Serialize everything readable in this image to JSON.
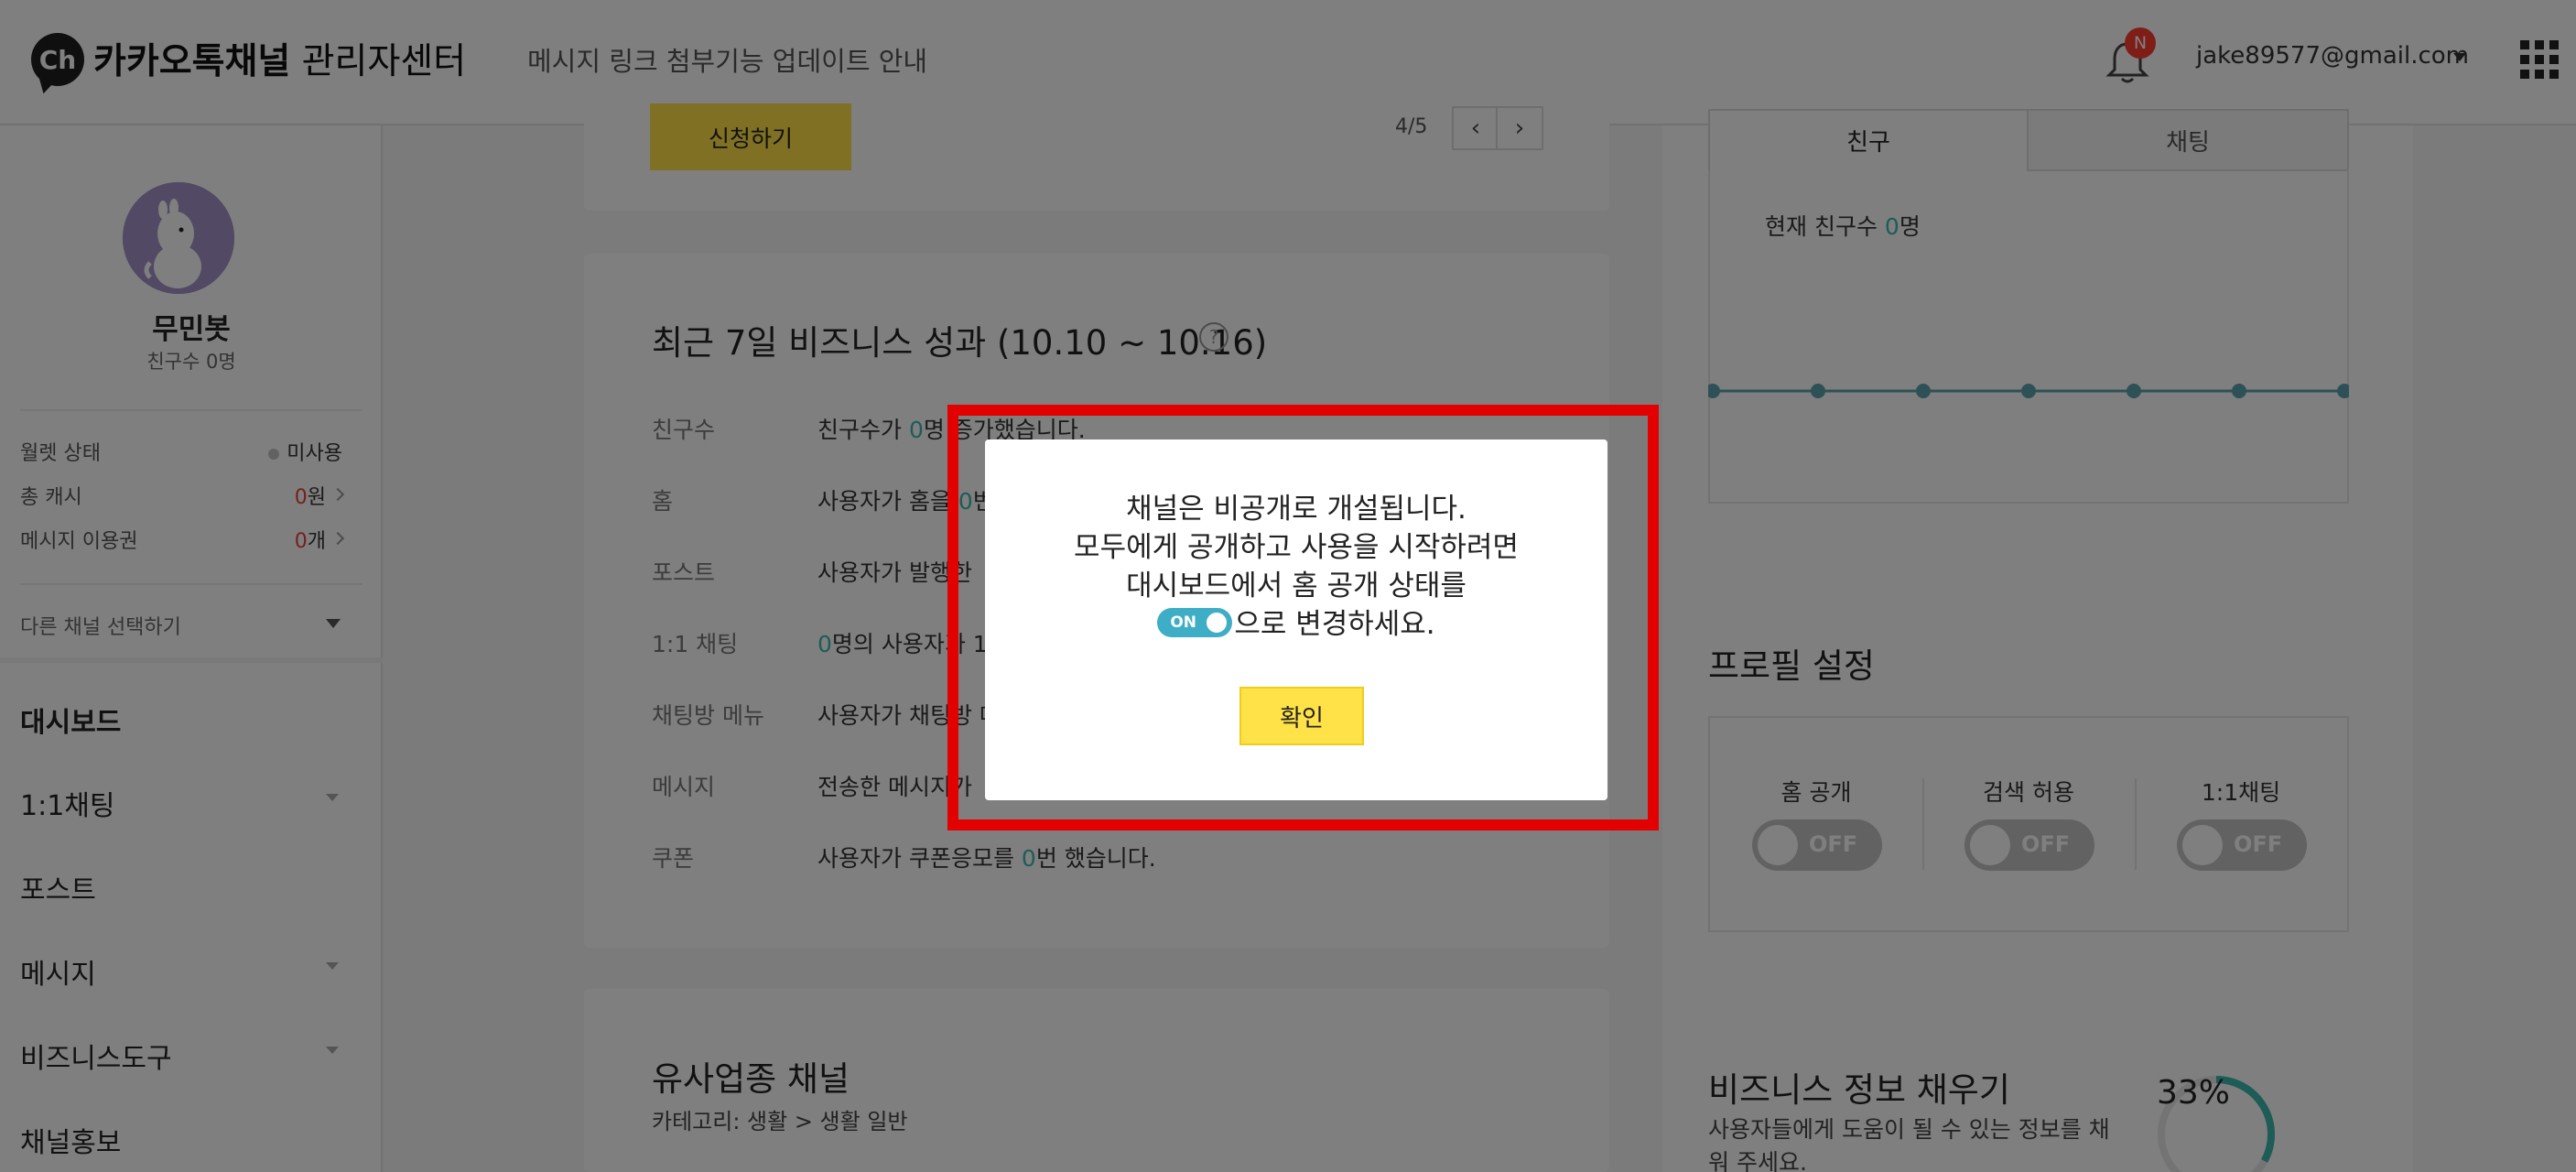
{
  "header": {
    "logo_text": "Ch",
    "title_bold": "카카오톡채널",
    "title_rest": " 관리자센터",
    "notice": "메시지 링크 첨부기능 업데이트 안내",
    "notification_badge": "N",
    "account": "jake89577@gmail.com"
  },
  "sidebar": {
    "profile_name": "무민봇",
    "friends_label": "친구수 ",
    "friends_count": "0명",
    "stats": [
      {
        "label": "월렛 상태",
        "value": "미사용"
      },
      {
        "label": "총 캐시",
        "value_num": "0",
        "value_unit": "원"
      },
      {
        "label": "메시지 이용권",
        "value_num": "0",
        "value_unit": "개"
      }
    ],
    "channel_select": "다른 채널 선택하기",
    "menu": [
      "대시보드",
      "1:1채팅",
      "포스트",
      "메시지",
      "비즈니스도구",
      "채널홍보"
    ]
  },
  "main": {
    "apply_button": "신청하기",
    "pager": "4/5",
    "prev": "‹",
    "next": "›",
    "perf_title": "최근 7일 비즈니스 성과 (10.10 ~ 10.16)",
    "help": "?",
    "rows": [
      {
        "label": "친구수",
        "pre": "친구수가 ",
        "num": "0",
        "post": "명 증가했습니다."
      },
      {
        "label": "홈",
        "pre": "사용자가 홈을 ",
        "num": "0",
        "post": "번"
      },
      {
        "label": "포스트",
        "pre": "사용자가 발행한 ",
        "num": "",
        "post": ""
      },
      {
        "label": "1:1 채팅",
        "pre": "",
        "num": "0",
        "post": "명의 사용자가 1"
      },
      {
        "label": "채팅방 메뉴",
        "pre": "사용자가 채팅방 메",
        "num": "",
        "post": ""
      },
      {
        "label": "메시지",
        "pre": "전송한 메시지가 ",
        "num": "",
        "post": ""
      },
      {
        "label": "쿠폰",
        "pre": "사용자가 쿠폰응모를 ",
        "num": "0",
        "post": "번 했습니다."
      }
    ],
    "similar_title": "유사업종 채널",
    "similar_category": "카테고리: 생활 > 생활 일반"
  },
  "right": {
    "tabs": [
      "친구",
      "채팅"
    ],
    "friends_now_pre": "현재 친구수 ",
    "friends_now_num": "0",
    "friends_now_post": "명",
    "chart_data": {
      "type": "line",
      "series": [
        {
          "values": [
            0,
            0,
            0,
            0,
            0,
            0,
            0
          ]
        }
      ]
    },
    "profile_title": "프로필 설정",
    "toggles": [
      {
        "label": "홈 공개",
        "state": "OFF"
      },
      {
        "label": "검색 허용",
        "state": "OFF"
      },
      {
        "label": "1:1채팅",
        "state": "OFF"
      }
    ],
    "biz_title": "비즈니스 정보 채우기",
    "biz_sub": "사용자들에게 도움이 될 수 있는 정보를 채워 주세요.",
    "biz_progress": "33%",
    "biz_progress_value": 0.33
  },
  "modal": {
    "line1": "채널은 비공개로 개설됩니다.",
    "line2": "모두에게 공개하고 사용을 시작하려면",
    "line3": "대시보드에서 홈 공개 상태를",
    "toggle_text": "ON",
    "line4_suffix": "으로 변경하세요.",
    "confirm": "확인"
  },
  "colors": {
    "accent_yellow": "#ffe148",
    "accent_teal": "#3cb8b0",
    "toggle_on": "#3eaec6",
    "highlight_red": "#e30000"
  }
}
